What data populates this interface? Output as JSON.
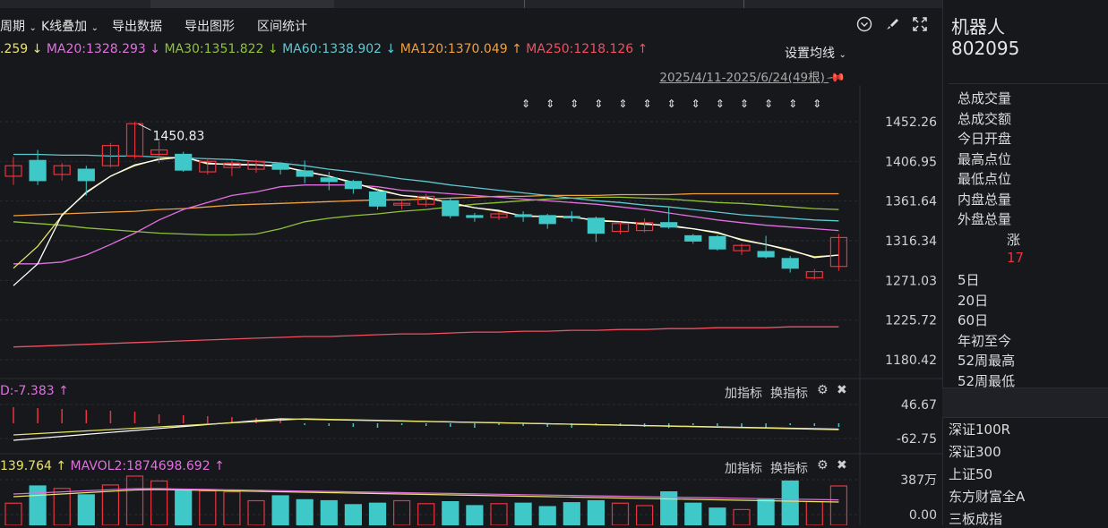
{
  "toolbar": {
    "period": "周期",
    "overlay": "K线叠加",
    "export_data": "导出数据",
    "export_chart": "导出图形",
    "range_stats": "区间统计"
  },
  "ma_line": [
    {
      "text": ".259",
      "color": "#e8e36a"
    },
    {
      "text": "↓",
      "color": "#e8e36a"
    },
    {
      "text": "MA20:1328.293",
      "color": "#e070e0"
    },
    {
      "text": "↓",
      "color": "#e070e0"
    },
    {
      "text": "MA30:1351.822",
      "color": "#8fc23a"
    },
    {
      "text": "↓",
      "color": "#8fc23a"
    },
    {
      "text": "MA60:1338.902",
      "color": "#5ec8d0"
    },
    {
      "text": "↓",
      "color": "#5ec8d0"
    },
    {
      "text": "MA120:1370.049",
      "color": "#f0a040"
    },
    {
      "text": "↑",
      "color": "#f0a040"
    },
    {
      "text": "MA250:1218.126",
      "color": "#f05060"
    },
    {
      "text": "↑",
      "color": "#f05060"
    }
  ],
  "setting_ma": "设置均线",
  "range_label": "2025/4/11-2025/6/24(49根)",
  "macd_header": "D:-7.383",
  "macd_arrow": "↑",
  "vol_header": {
    "left": "139.764",
    "arrow1": "↑",
    "mavol2": "MAVOL2:1874698.692",
    "arrow2": "↑"
  },
  "sub_tools": {
    "add": "加指标",
    "switch": "换指标"
  },
  "side": {
    "name": "机器人",
    "code": "802095",
    "rows": [
      "总成交量",
      "总成交额",
      "今日开盘",
      "最高点位",
      "最低点位",
      "内盘总量",
      "外盘总量"
    ],
    "change_label": "涨",
    "change_value": "17",
    "periods": [
      "5日",
      "20日",
      "60日",
      "年初至今",
      "52周最高",
      "52周最低"
    ],
    "indices": [
      "深证100R",
      "深证300",
      "上证50",
      "东方财富全A",
      "三板成指"
    ]
  },
  "colors": {
    "up": "#e8343f",
    "down": "#3ec8c8",
    "bg": "#17181c"
  },
  "chart_data": {
    "type": "candlestick",
    "y_ticks": [
      "1452.26",
      "1406.95",
      "1361.64",
      "1316.34",
      "1271.03",
      "1225.72",
      "1180.42"
    ],
    "ylim": [
      1150,
      1470
    ],
    "annotation": "1450.83",
    "candles": [
      [
        1390,
        1402,
        1380,
        1412
      ],
      [
        1408,
        1385,
        1380,
        1420
      ],
      [
        1392,
        1402,
        1385,
        1405
      ],
      [
        1398,
        1385,
        1368,
        1402
      ],
      [
        1402,
        1425,
        1400,
        1428
      ],
      [
        1413,
        1450,
        1410,
        1452
      ],
      [
        1415,
        1420,
        1405,
        1430
      ],
      [
        1415,
        1397,
        1395,
        1418
      ],
      [
        1395,
        1407,
        1392,
        1410
      ],
      [
        1400,
        1405,
        1390,
        1408
      ],
      [
        1398,
        1407,
        1394,
        1409
      ],
      [
        1404,
        1398,
        1392,
        1405
      ],
      [
        1396,
        1390,
        1382,
        1408
      ],
      [
        1388,
        1384,
        1374,
        1395
      ],
      [
        1384,
        1376,
        1370,
        1386
      ],
      [
        1372,
        1356,
        1352,
        1375
      ],
      [
        1357,
        1359,
        1352,
        1362
      ],
      [
        1358,
        1367,
        1355,
        1370
      ],
      [
        1362,
        1345,
        1342,
        1365
      ],
      [
        1345,
        1343,
        1338,
        1348
      ],
      [
        1343,
        1347,
        1340,
        1349
      ],
      [
        1346,
        1344,
        1338,
        1350
      ],
      [
        1345,
        1336,
        1330,
        1347
      ],
      [
        1344,
        1343,
        1338,
        1350
      ],
      [
        1342,
        1325,
        1315,
        1344
      ],
      [
        1327,
        1336,
        1324,
        1338
      ],
      [
        1328,
        1337,
        1326,
        1342
      ],
      [
        1337,
        1332,
        1330,
        1355
      ],
      [
        1322,
        1316,
        1313,
        1324
      ],
      [
        1321,
        1307,
        1305,
        1323
      ],
      [
        1305,
        1311,
        1300,
        1313
      ],
      [
        1304,
        1298,
        1296,
        1322
      ],
      [
        1296,
        1285,
        1280,
        1299
      ],
      [
        1274,
        1281,
        1272,
        1284
      ],
      [
        1287,
        1320,
        1282,
        1324
      ]
    ],
    "ma5": [
      1285,
      1310,
      1345,
      1372,
      1390,
      1402,
      1410,
      1412,
      1404,
      1404,
      1403,
      1401,
      1396,
      1390,
      1382,
      1375,
      1368,
      1365,
      1360,
      1354,
      1350,
      1345,
      1344,
      1343,
      1340,
      1338,
      1335,
      1334,
      1330,
      1325,
      1318,
      1312,
      1305,
      1298,
      1300
    ],
    "ma20": [
      1290,
      1290,
      1292,
      1300,
      1312,
      1325,
      1340,
      1352,
      1360,
      1368,
      1372,
      1378,
      1380,
      1380,
      1380,
      1378,
      1374,
      1372,
      1370,
      1368,
      1366,
      1364,
      1362,
      1360,
      1358,
      1355,
      1352,
      1348,
      1344,
      1340,
      1337,
      1334,
      1332,
      1330,
      1328
    ],
    "ma30": [
      1338,
      1336,
      1334,
      1331,
      1329,
      1327,
      1325,
      1324,
      1323,
      1323,
      1324,
      1330,
      1338,
      1342,
      1345,
      1347,
      1350,
      1352,
      1355,
      1358,
      1360,
      1362,
      1364,
      1365,
      1366,
      1366,
      1365,
      1364,
      1362,
      1360,
      1359,
      1357,
      1355,
      1353,
      1352
    ],
    "ma60": [
      1415,
      1415,
      1414,
      1414,
      1413,
      1413,
      1412,
      1411,
      1410,
      1409,
      1407,
      1405,
      1402,
      1398,
      1395,
      1391,
      1387,
      1384,
      1380,
      1377,
      1374,
      1371,
      1368,
      1365,
      1362,
      1360,
      1357,
      1355,
      1352,
      1349,
      1346,
      1344,
      1342,
      1340,
      1339
    ],
    "ma120": [
      1345,
      1346,
      1347,
      1348,
      1349,
      1350,
      1352,
      1353,
      1355,
      1357,
      1358,
      1359,
      1360,
      1361,
      1362,
      1363,
      1363,
      1364,
      1365,
      1366,
      1367,
      1367,
      1368,
      1368,
      1368,
      1369,
      1369,
      1369,
      1370,
      1370,
      1370,
      1370,
      1370,
      1370,
      1370
    ],
    "ma250": [
      1195,
      1196,
      1197,
      1198,
      1199,
      1200,
      1201,
      1202,
      1203,
      1204,
      1205,
      1206,
      1207,
      1207,
      1208,
      1209,
      1210,
      1210,
      1211,
      1212,
      1212,
      1213,
      1213,
      1214,
      1214,
      1215,
      1215,
      1216,
      1216,
      1217,
      1217,
      1217,
      1218,
      1218,
      1218
    ],
    "macd_ticks": [
      "46.67",
      "-62.75"
    ],
    "vol_ticks": [
      "387万",
      "0.00"
    ],
    "volumes": [
      0.45,
      0.8,
      0.75,
      0.62,
      0.82,
      1.0,
      0.9,
      0.7,
      0.7,
      0.68,
      0.5,
      0.6,
      0.52,
      0.5,
      0.42,
      0.45,
      0.5,
      0.44,
      0.48,
      0.4,
      0.44,
      0.45,
      0.38,
      0.46,
      0.5,
      0.45,
      0.4,
      0.68,
      0.45,
      0.35,
      0.32,
      0.52,
      0.9,
      0.48,
      0.8
    ]
  }
}
